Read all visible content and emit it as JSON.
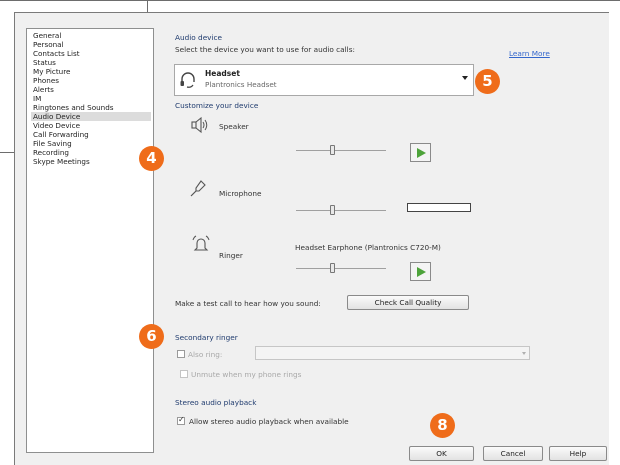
{
  "nav": {
    "items": [
      {
        "label": "General"
      },
      {
        "label": "Personal"
      },
      {
        "label": "Contacts List"
      },
      {
        "label": "Status"
      },
      {
        "label": "My Picture"
      },
      {
        "label": "Phones"
      },
      {
        "label": "Alerts"
      },
      {
        "label": "IM"
      },
      {
        "label": "Ringtones and Sounds"
      },
      {
        "label": "Audio Device"
      },
      {
        "label": "Video Device"
      },
      {
        "label": "Call Forwarding"
      },
      {
        "label": "File Saving"
      },
      {
        "label": "Recording"
      },
      {
        "label": "Skype Meetings"
      }
    ],
    "selected": "Audio Device"
  },
  "audio": {
    "heading": "Audio device",
    "instruction": "Select the device you want to use for audio calls:",
    "learn_more": "Learn More",
    "device_name": "Headset",
    "device_sub": "Plantronics Headset",
    "customize": "Customize your device",
    "speaker_label": "Speaker",
    "microphone_label": "Microphone",
    "ringer_label": "Ringer",
    "ringer_device": "Headset Earphone (Plantronics C720-M)",
    "test_call_text": "Make a test call to hear how you sound:",
    "check_call_quality": "Check Call Quality"
  },
  "secondary": {
    "heading": "Secondary ringer",
    "also_ring": "Also ring:",
    "unmute": "Unmute when my phone rings"
  },
  "stereo": {
    "heading": "Stereo audio playback",
    "allow": "Allow stereo audio playback when available",
    "checked": true
  },
  "buttons": {
    "ok": "OK",
    "cancel": "Cancel",
    "help": "Help"
  },
  "badges": {
    "b4": "4",
    "b5": "5",
    "b6": "6",
    "b8": "8"
  },
  "colors": {
    "badge": "#ef6c1a",
    "play": "#4da33a",
    "link": "#3366cc"
  }
}
